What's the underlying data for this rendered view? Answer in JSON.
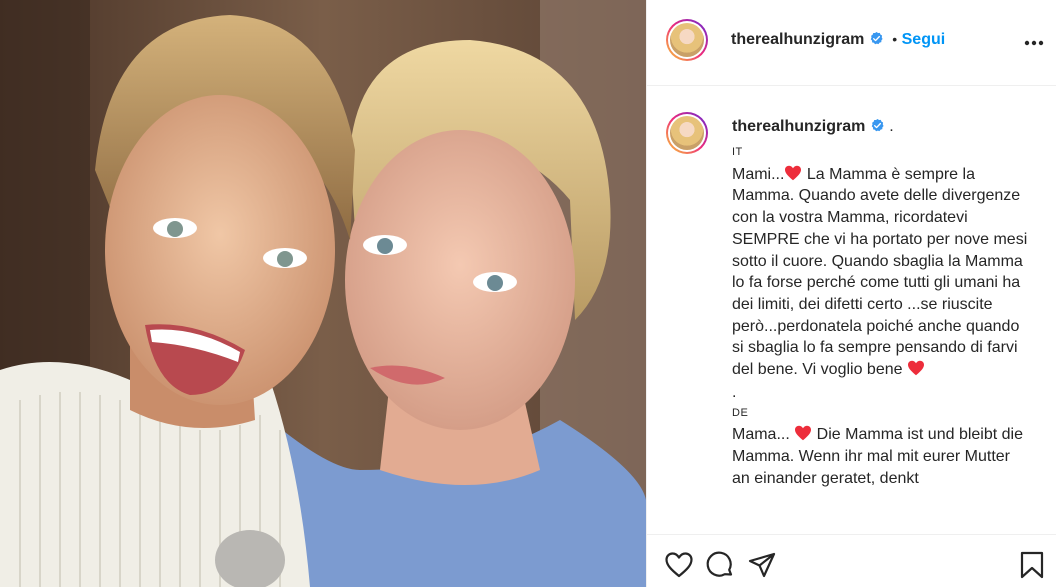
{
  "header": {
    "username": "therealhunzigram",
    "separator": "•",
    "follow_label": "Segui",
    "more_icon": "more-horizontal-icon"
  },
  "caption": {
    "username": "therealhunzigram",
    "dot": ".",
    "it_label": "IT",
    "it_intro": "Mami...",
    "it_text_1": " La Mamma è sempre la Mamma. Quando avete delle divergenze con la vostra Mamma, ricordatevi SEMPRE che vi ha portato per nove mesi sotto il cuore. Quando sbaglia la Mamma lo fa forse perché come tutti gli umani ha dei limiti, dei difetti certo ...se riuscite però...perdonatela poiché anche quando si sbaglia lo fa sempre pensando di farvi del bene. Vi voglio bene ",
    "separator_dot": ".",
    "de_label": "DE",
    "de_intro": "Mama... ",
    "de_text_1": " Die Mamma ist und bleibt die Mamma. Wenn ihr mal mit eurer Mutter an einander geratet, denkt"
  },
  "actions": {
    "like_icon": "heart-outline-icon",
    "comment_icon": "comment-icon",
    "share_icon": "paper-plane-icon",
    "save_icon": "bookmark-icon"
  },
  "colors": {
    "accent": "#0095f6",
    "heart": "#ed2d3b",
    "verified": "#3897f0"
  }
}
